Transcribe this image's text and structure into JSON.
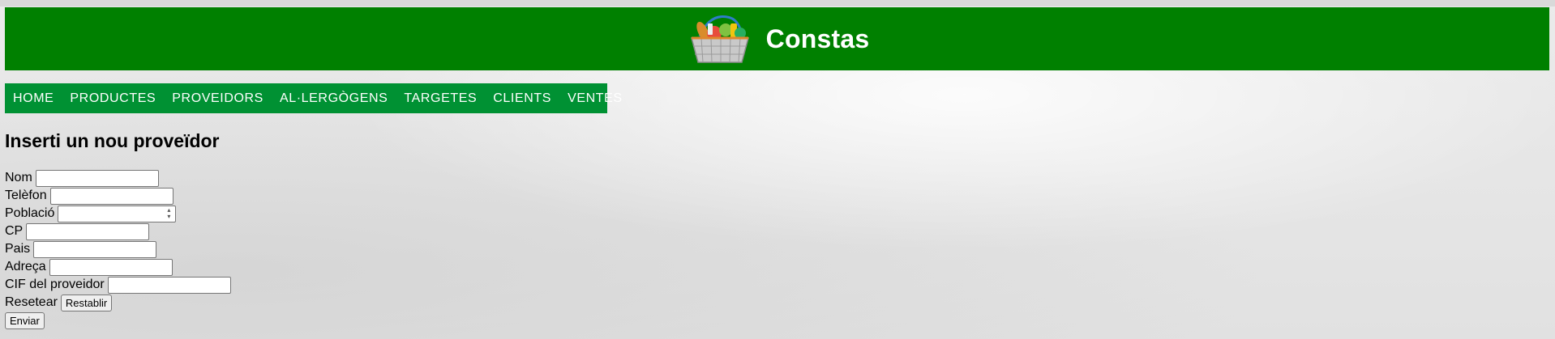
{
  "header": {
    "title": "Constas",
    "logo_icon": "shopping-basket-icon",
    "background_color": "#008000"
  },
  "nav": {
    "background_color": "#009133",
    "items": [
      {
        "label": "HOME"
      },
      {
        "label": "PRODUCTES"
      },
      {
        "label": "PROVEIDORS"
      },
      {
        "label": "AL·LERGÒGENS"
      },
      {
        "label": "TARGETES"
      },
      {
        "label": "CLIENTS"
      },
      {
        "label": "VENTES"
      }
    ]
  },
  "main": {
    "heading": "Inserti un nou proveïdor",
    "form": {
      "fields": [
        {
          "label": "Nom",
          "value": ""
        },
        {
          "label": "Telèfon",
          "value": ""
        },
        {
          "label": "Població",
          "value": ""
        },
        {
          "label": "CP",
          "value": ""
        },
        {
          "label": "Pais",
          "value": ""
        },
        {
          "label": "Adreça",
          "value": ""
        },
        {
          "label": "CIF del proveidor",
          "value": ""
        }
      ],
      "reset_label": "Resetear",
      "reset_button": "Restablir",
      "submit_button": "Enviar"
    }
  }
}
